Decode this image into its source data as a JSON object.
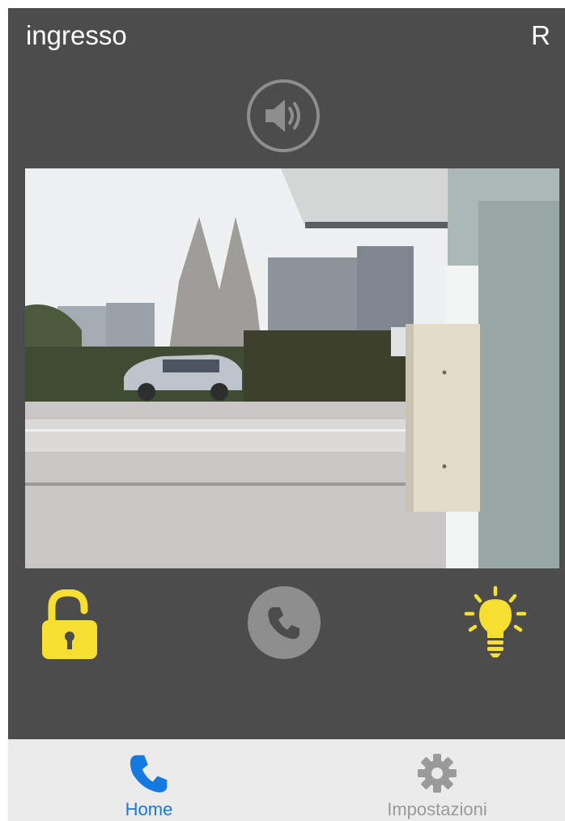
{
  "header": {
    "title": "ingresso",
    "right_label": "R"
  },
  "controls": {
    "speaker_icon": "speaker-volume-icon",
    "unlock_icon": "unlocked-padlock-icon",
    "call_icon": "phone-icon",
    "light_icon": "lightbulb-icon"
  },
  "tabbar": {
    "tabs": [
      {
        "label": "Home",
        "icon": "phone-icon",
        "active": true
      },
      {
        "label": "Impostazioni",
        "icon": "gear-icon",
        "active": false
      }
    ]
  },
  "colors": {
    "background": "#4c4c4c",
    "accent_yellow": "#f6df2e",
    "control_gray": "#8e8e8e",
    "tab_active": "#1479e0",
    "tab_inactive": "#9a9a9a",
    "tabbar_bg": "#ebebeb"
  }
}
